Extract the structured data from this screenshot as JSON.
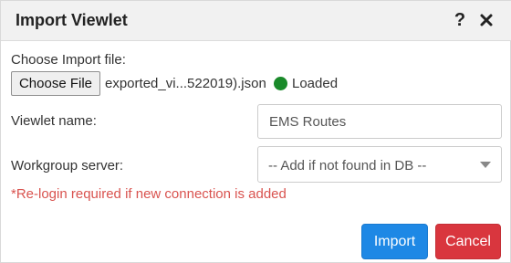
{
  "dialog": {
    "title": "Import Viewlet",
    "help_glyph": "?",
    "help_icon": "help-icon",
    "close_icon": "close-icon"
  },
  "import_file": {
    "label": "Choose Import file:",
    "button_label": "Choose File",
    "file_name": "exported_vi...522019).json",
    "status": "Loaded",
    "status_color": "#1a8a2a"
  },
  "viewlet_name": {
    "label": "Viewlet name:",
    "value": "EMS Routes"
  },
  "workgroup_server": {
    "label": "Workgroup server:",
    "selected": "-- Add if not found in DB --"
  },
  "note": "*Re-login required if new connection is added",
  "buttons": {
    "import": "Import",
    "cancel": "Cancel"
  },
  "colors": {
    "accent": "#1e88e5",
    "danger": "#d9363e",
    "note": "#d9534f"
  }
}
